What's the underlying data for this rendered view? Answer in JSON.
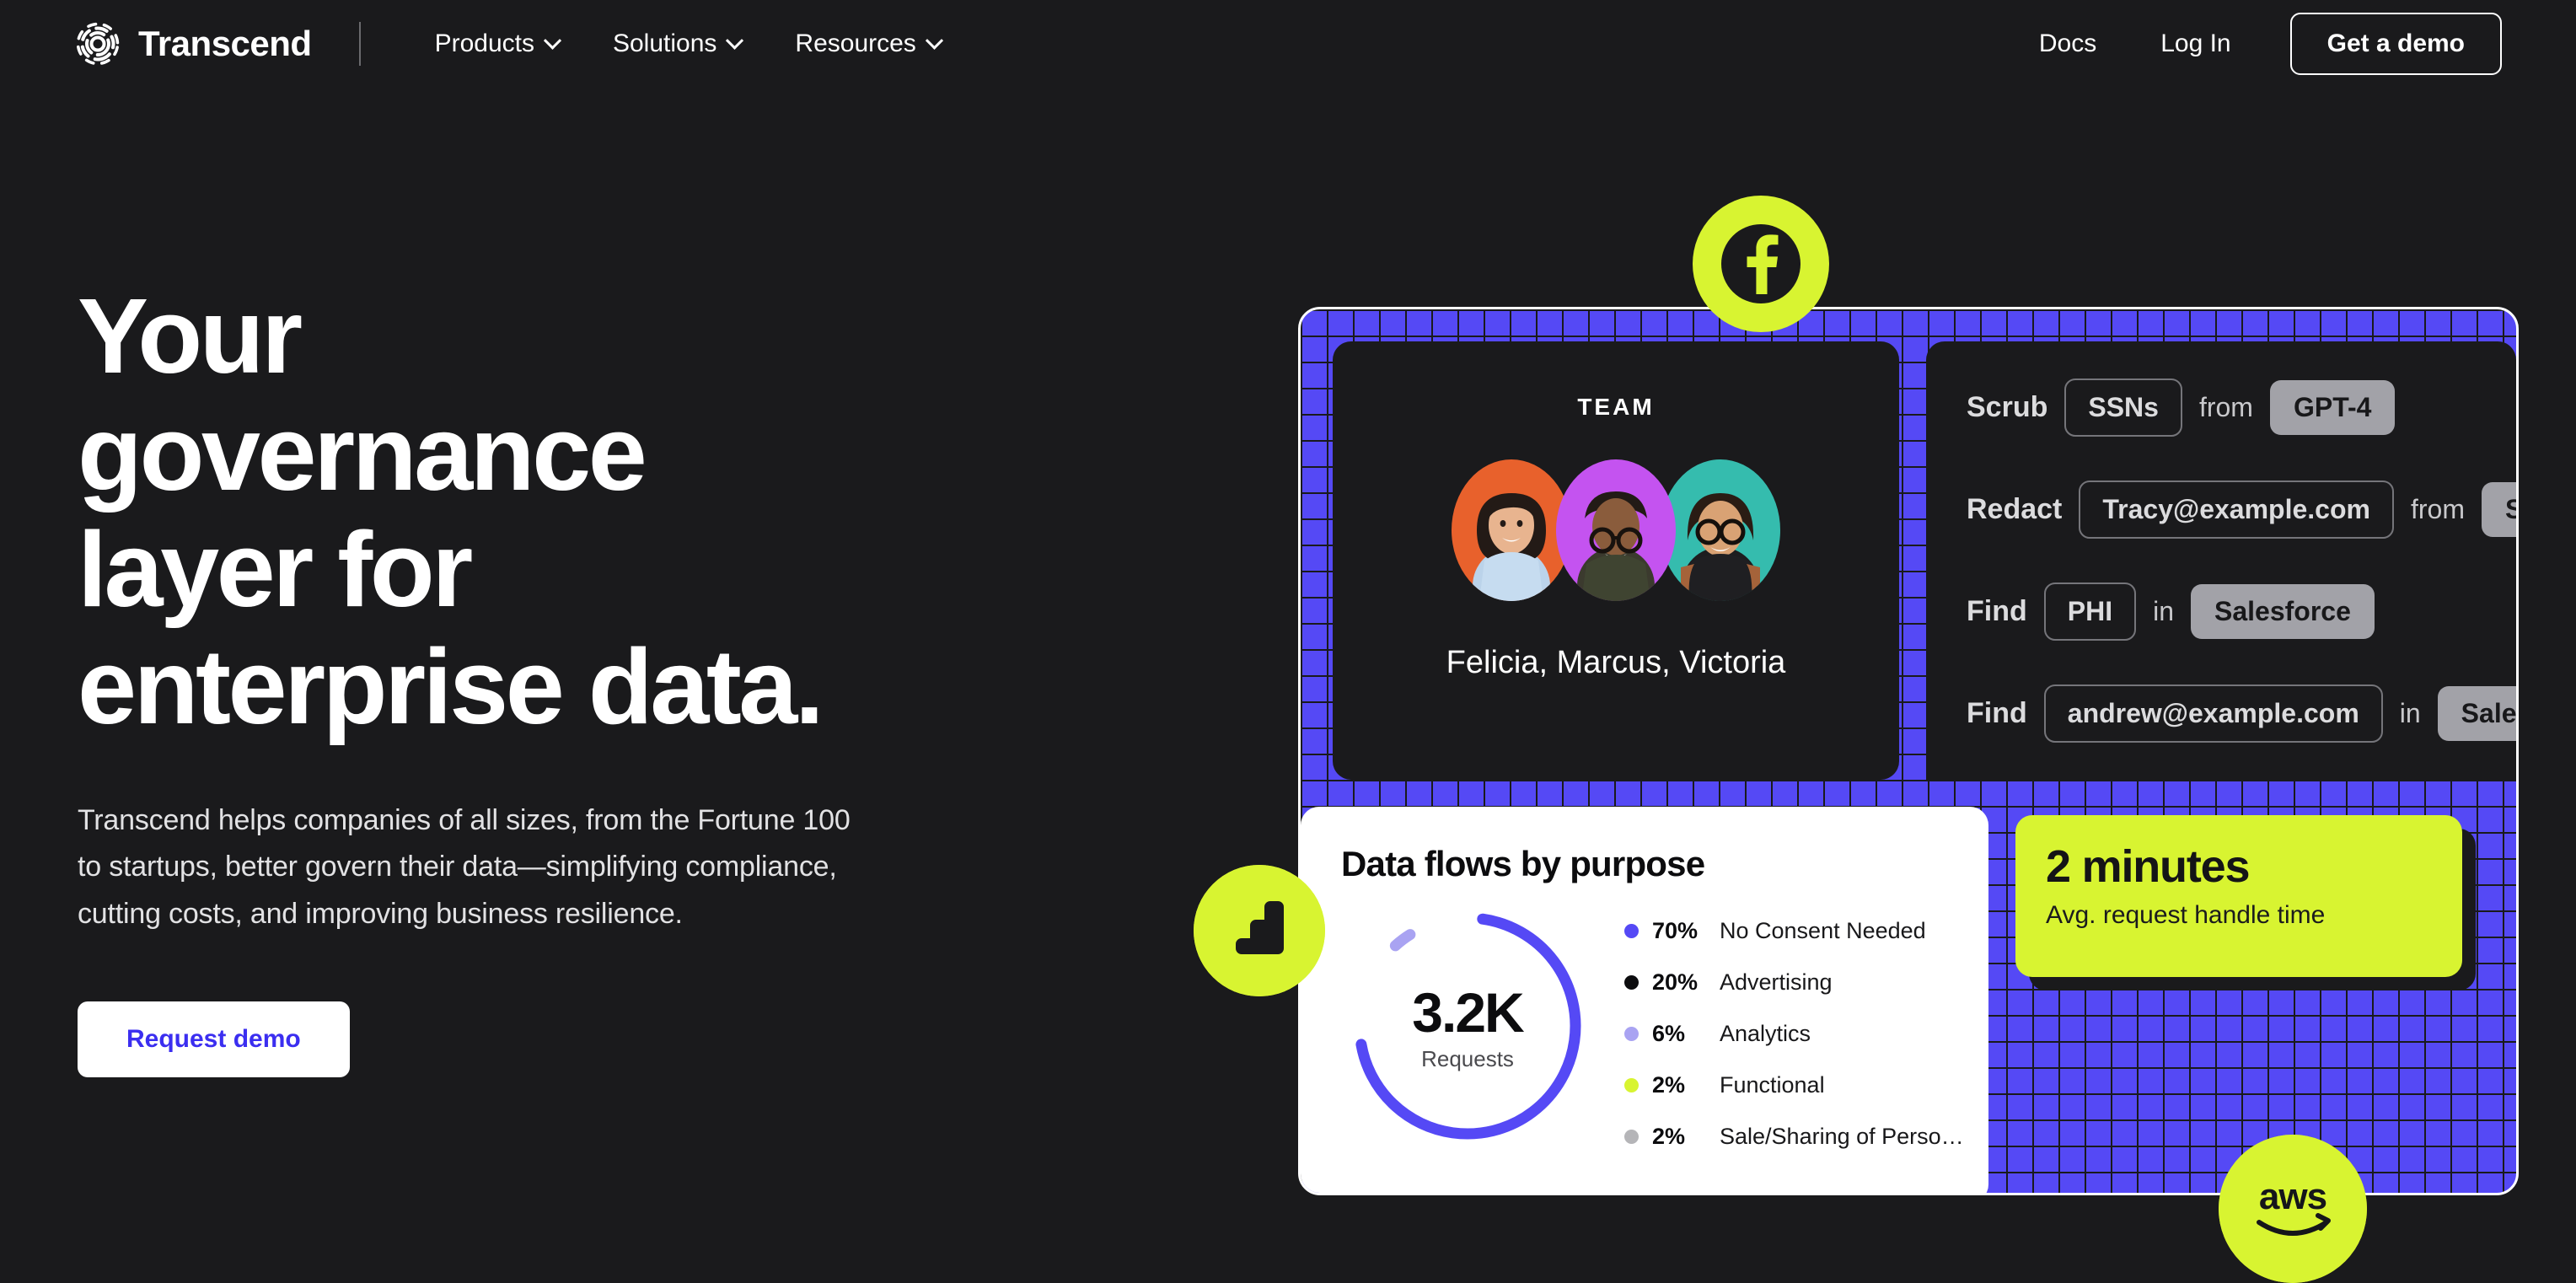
{
  "colors": {
    "bg": "#1A1A1C",
    "accent_blue": "#5549F5",
    "accent_green": "#D8F431",
    "button_text_blue": "#3B2EF0",
    "white": "#FFFFFF"
  },
  "nav": {
    "brand": "Transcend",
    "brand_icon": "transcend-rings-logo",
    "links": [
      {
        "label": "Products",
        "has_dropdown": true
      },
      {
        "label": "Solutions",
        "has_dropdown": true
      },
      {
        "label": "Resources",
        "has_dropdown": true
      }
    ],
    "right_links": [
      {
        "label": "Docs"
      },
      {
        "label": "Log In"
      }
    ],
    "cta": "Get a demo"
  },
  "hero": {
    "headline_lines": [
      "Your",
      "governance",
      "layer for",
      "enterprise data."
    ],
    "subcopy": "Transcend helps companies of all sizes, from the Fortune 100 to startups, better govern their data—simplifying compliance, cutting costs, and improving business resilience.",
    "cta": "Request demo"
  },
  "visual": {
    "team_card": {
      "label": "TEAM",
      "names": "Felicia, Marcus, Victoria",
      "avatars": [
        {
          "name": "Felicia",
          "bg": "#E8612C"
        },
        {
          "name": "Marcus",
          "bg": "#C453F0"
        },
        {
          "name": "Victoria",
          "bg": "#35BCAE"
        }
      ]
    },
    "ops_rows": [
      {
        "verb": "Scrub",
        "chip": "SSNs",
        "prep": "from",
        "target": "GPT-4"
      },
      {
        "verb": "Redact",
        "chip": "Tracy@example.com",
        "prep": "from",
        "target": "Slack"
      },
      {
        "verb": "Find",
        "chip": "PHI",
        "prep": "in",
        "target": "Salesforce"
      },
      {
        "verb": "Find",
        "chip": "andrew@example.com",
        "prep": "in",
        "target": "Salesforce"
      }
    ],
    "stat_card": {
      "value": "2 minutes",
      "label": "Avg. request handle time"
    },
    "badges": [
      {
        "icon": "facebook-icon",
        "name": "Facebook"
      },
      {
        "icon": "bar-steps-icon",
        "name": "Analytics"
      },
      {
        "icon": "aws-icon",
        "name": "aws"
      }
    ]
  },
  "chart_data": {
    "type": "pie",
    "title": "Data flows by purpose",
    "center_value": "3.2K",
    "center_label": "Requests",
    "total_requests": 3200,
    "categories": [
      "No Consent Needed",
      "Advertising",
      "Analytics",
      "Functional",
      "Sale/Sharing of Perso…"
    ],
    "values": [
      70,
      20,
      6,
      2,
      2
    ],
    "value_labels": [
      "70%",
      "20%",
      "6%",
      "2%",
      "2%"
    ],
    "colors": [
      "#5549F5",
      "#0C0C0E",
      "#A9A3F2",
      "#D8F431",
      "#B5B5B8"
    ],
    "legend_position": "right",
    "grid": false,
    "xlabel": "",
    "ylabel": ""
  }
}
